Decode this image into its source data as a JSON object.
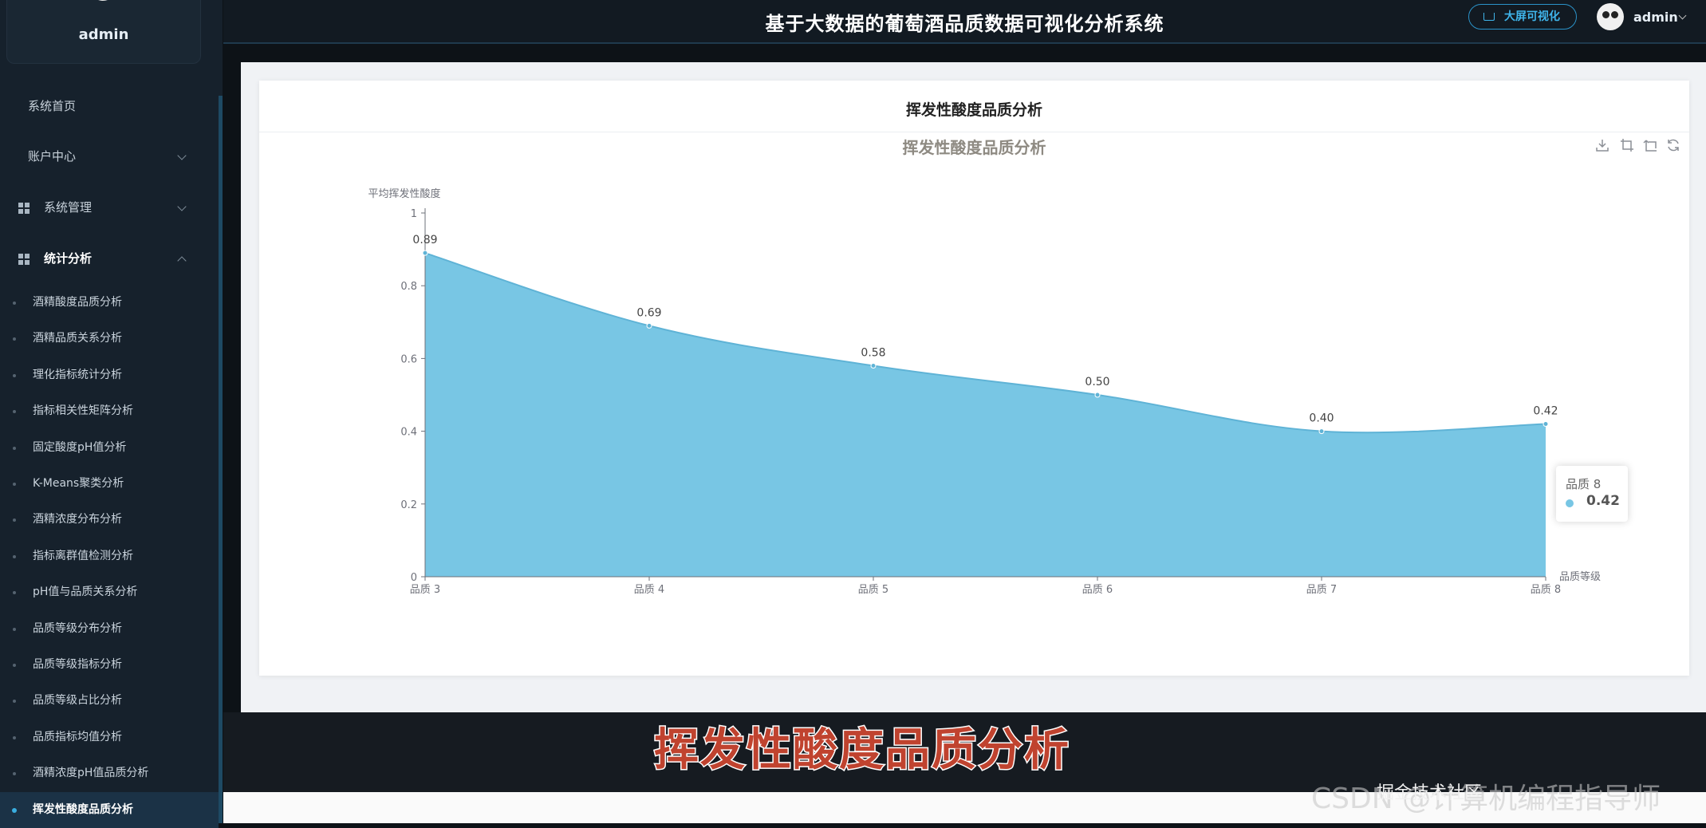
{
  "app": {
    "title": "基于大数据的葡萄酒品质数据可视化分析系统",
    "big_screen_label": "大屏可视化",
    "user": "admin"
  },
  "sidebar": {
    "user_name": "admin",
    "top_items": [
      {
        "label": "系统首页"
      },
      {
        "label": "账户中心"
      },
      {
        "label": "系统管理"
      },
      {
        "label": "统计分析"
      }
    ],
    "sub_items": [
      "酒精酸度品质分析",
      "酒精品质关系分析",
      "理化指标统计分析",
      "指标相关性矩阵分析",
      "固定酸度pH值分析",
      "K-Means聚类分析",
      "酒精浓度分布分析",
      "指标离群值检测分析",
      "pH值与品质关系分析",
      "品质等级分布分析",
      "品质等级指标分析",
      "品质等级占比分析",
      "品质指标均值分析",
      "酒精浓度pH值品质分析",
      "挥发性酸度品质分析"
    ],
    "active_index": 14
  },
  "card": {
    "title": "挥发性酸度品质分析"
  },
  "chart_data": {
    "type": "area",
    "title": "挥发性酸度品质分析",
    "ylabel": "平均挥发性酸度",
    "xlabel": "品质等级",
    "categories": [
      "品质 3",
      "品质 4",
      "品质 5",
      "品质 6",
      "品质 7",
      "品质 8"
    ],
    "values": [
      0.89,
      0.69,
      0.58,
      0.5,
      0.4,
      0.42
    ],
    "value_labels": [
      "0.89",
      "0.69",
      "0.58",
      "0.50",
      "0.40",
      "0.42"
    ],
    "yticks": [
      "0",
      "0.2",
      "0.4",
      "0.6",
      "0.8",
      "1"
    ],
    "ylim": [
      0,
      1
    ],
    "smooth": true,
    "color": "#78c6e4",
    "line_color": "#5fb3d6"
  },
  "tooltip": {
    "label": "品质 8",
    "value": "0.42"
  },
  "caption": "挥发性酸度品质分析",
  "watermark": "CSDN @计算机编程指导师",
  "watermark2": "掘金技术社区"
}
